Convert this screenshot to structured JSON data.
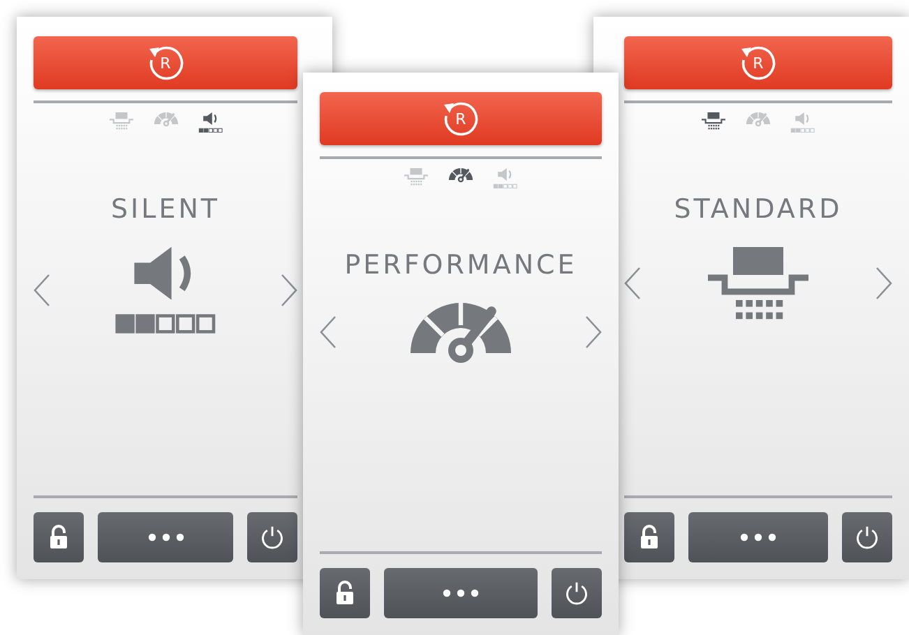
{
  "screens": [
    {
      "reset_label": "R",
      "indicators": [
        {
          "kind": "standard",
          "selected": false
        },
        {
          "kind": "performance",
          "selected": false
        },
        {
          "kind": "silent",
          "selected": true
        }
      ],
      "mode": {
        "kind": "silent",
        "title": "SILENT"
      }
    },
    {
      "reset_label": "R",
      "indicators": [
        {
          "kind": "standard",
          "selected": false
        },
        {
          "kind": "performance",
          "selected": true
        },
        {
          "kind": "silent",
          "selected": false
        }
      ],
      "mode": {
        "kind": "performance",
        "title": "PERFORMANCE"
      }
    },
    {
      "reset_label": "R",
      "indicators": [
        {
          "kind": "standard",
          "selected": true
        },
        {
          "kind": "performance",
          "selected": false
        },
        {
          "kind": "silent",
          "selected": false
        }
      ],
      "mode": {
        "kind": "standard",
        "title": "STANDARD"
      }
    }
  ]
}
